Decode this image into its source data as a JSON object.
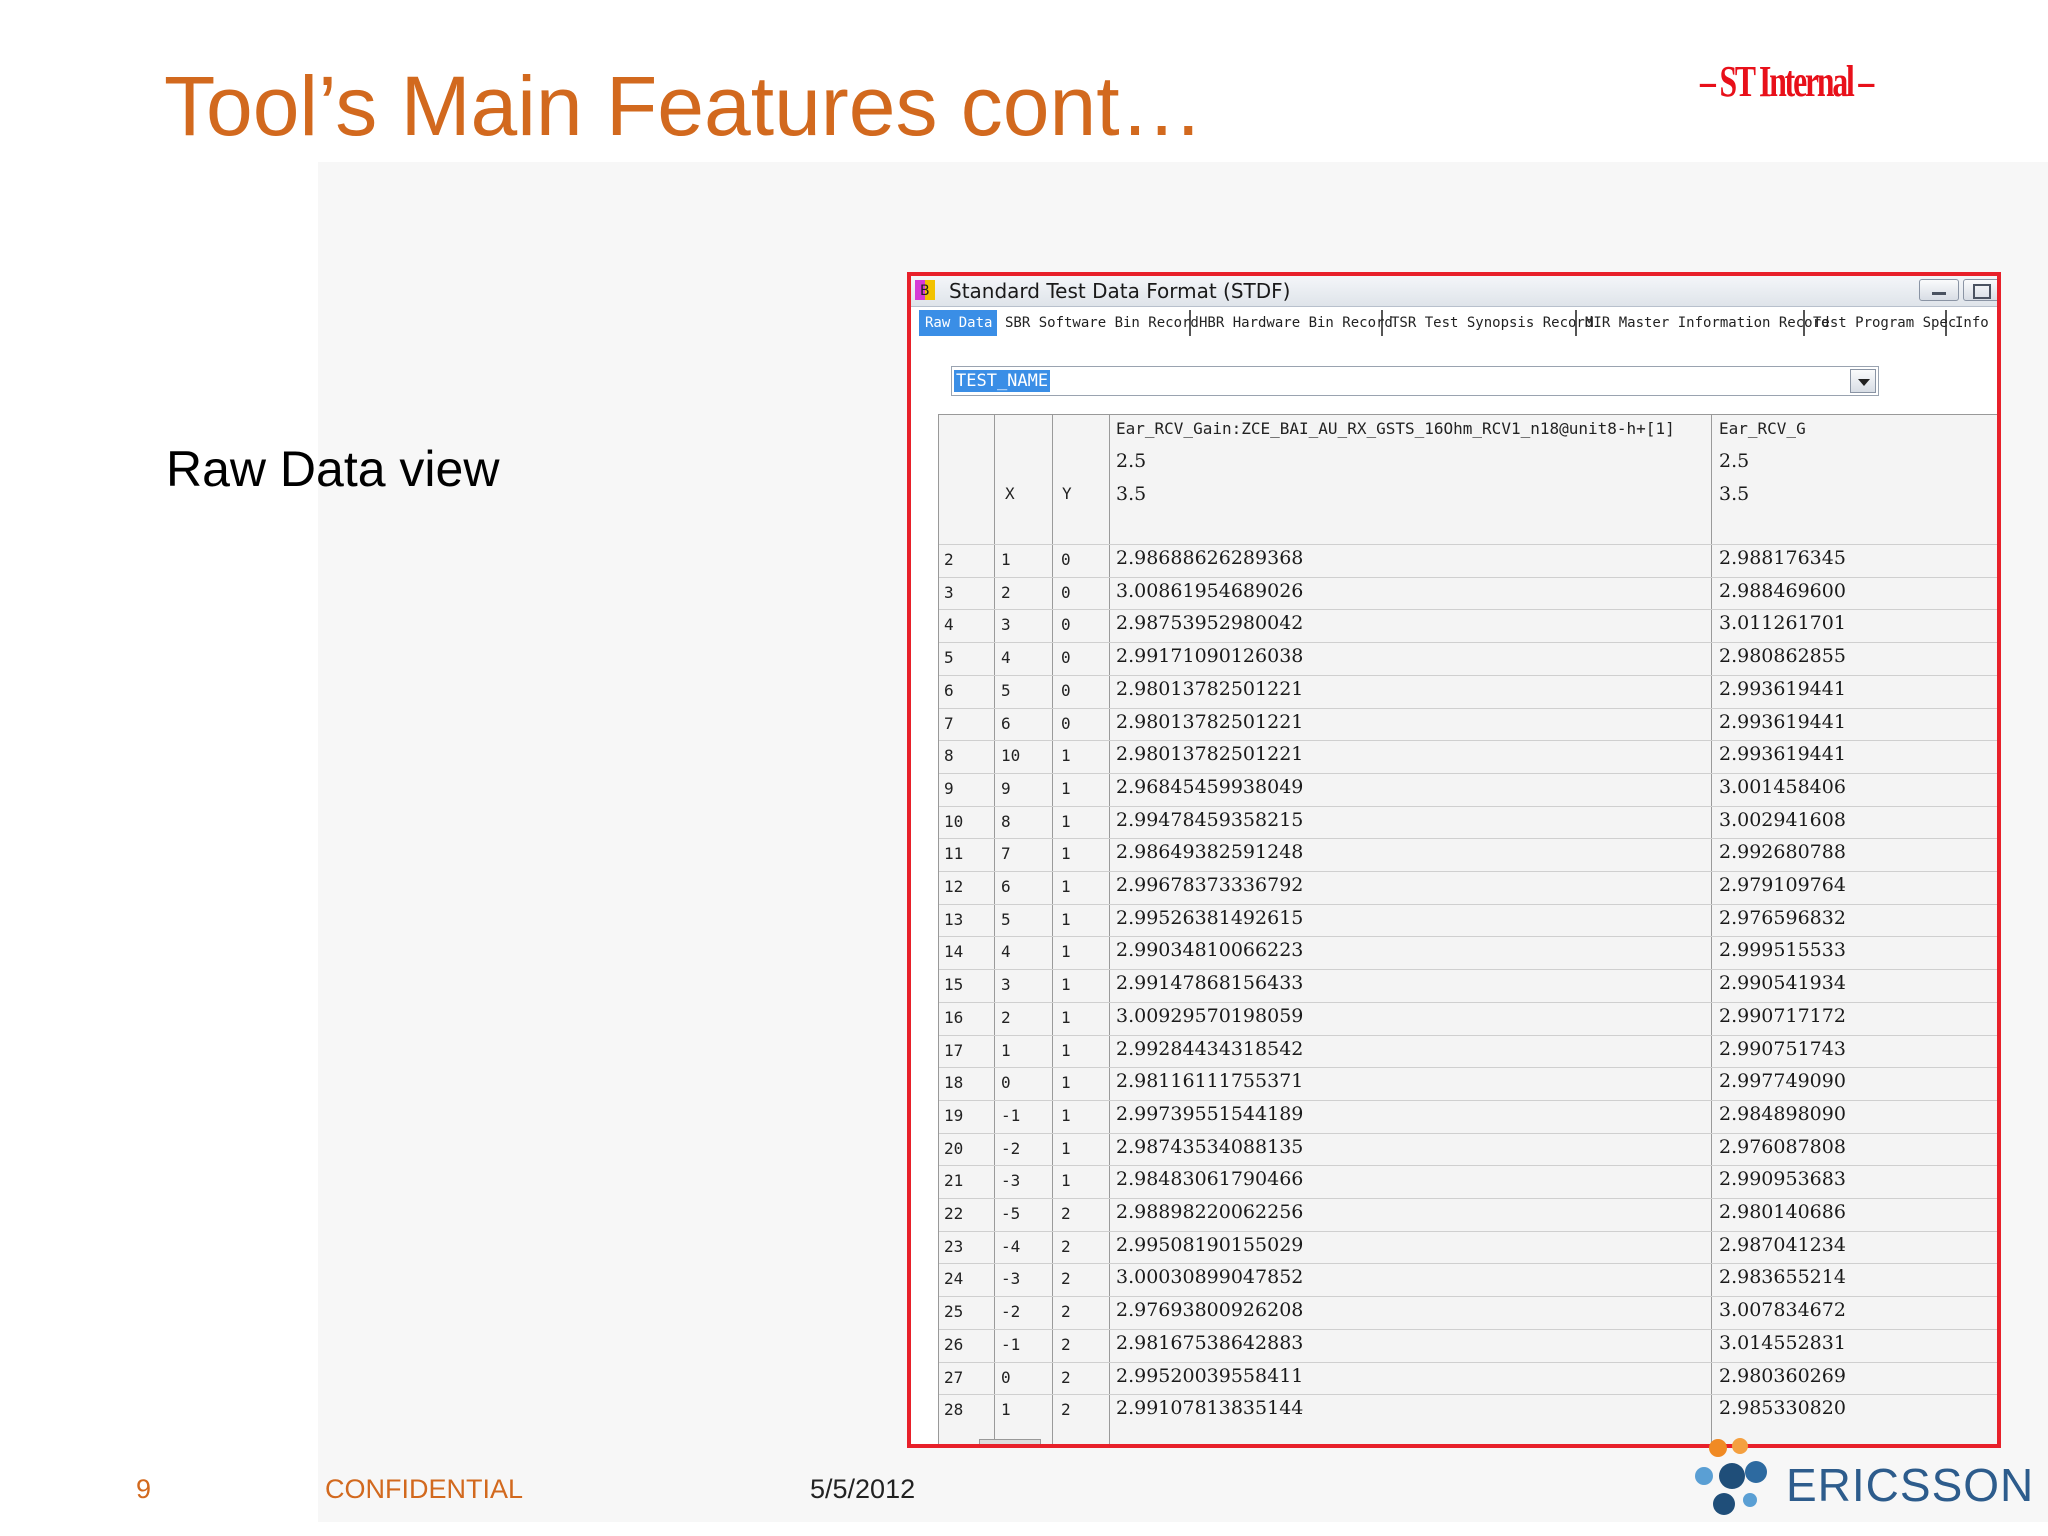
{
  "slide": {
    "title": "Tool’s Main Features cont…",
    "classification_stamp": "– ST Internal –",
    "subheading": "Raw Data view",
    "footer": {
      "page_number": "9",
      "confidential": "CONFIDENTIAL",
      "date": "5/5/2012"
    },
    "logo_text": "ERICSSON"
  },
  "window": {
    "title": "Standard Test Data Format (STDF)",
    "icon": "stdf-app-icon",
    "tabs": [
      {
        "label": "Raw Data",
        "active": true
      },
      {
        "label": "SBR Software Bin Record",
        "active": false
      },
      {
        "label": "HBR Hardware Bin Record",
        "active": false
      },
      {
        "label": "TSR Test Synopsis Record",
        "active": false
      },
      {
        "label": "MIR Master Information Record",
        "active": false
      },
      {
        "label": "Test Program Spec",
        "active": false
      },
      {
        "label": "Info",
        "active": false
      }
    ],
    "test_select": {
      "value": "TEST_NAME"
    },
    "table": {
      "header": {
        "col1_name": "Ear_RCV_Gain:ZCE_BAI_AU_RX_GSTS_16Ohm_RCV1_n18@unit8-h+[1]",
        "col2_name": "Ear_RCV_G",
        "limit_lo_1": "2.5",
        "limit_lo_2": "2.5",
        "limit_hi_1": "3.5",
        "limit_hi_2": "3.5",
        "x_label": "X",
        "y_label": "Y"
      },
      "rows": [
        {
          "idx": "2",
          "x": "1",
          "y": "0",
          "v1": "2.98688626289368",
          "v2": "2.988176345"
        },
        {
          "idx": "3",
          "x": "2",
          "y": "0",
          "v1": "3.00861954689026",
          "v2": "2.988469600"
        },
        {
          "idx": "4",
          "x": "3",
          "y": "0",
          "v1": "2.98753952980042",
          "v2": "3.011261701"
        },
        {
          "idx": "5",
          "x": "4",
          "y": "0",
          "v1": "2.99171090126038",
          "v2": "2.980862855"
        },
        {
          "idx": "6",
          "x": "5",
          "y": "0",
          "v1": "2.98013782501221",
          "v2": "2.993619441"
        },
        {
          "idx": "7",
          "x": "6",
          "y": "0",
          "v1": "2.98013782501221",
          "v2": "2.993619441"
        },
        {
          "idx": "8",
          "x": "10",
          "y": "1",
          "v1": "2.98013782501221",
          "v2": "2.993619441"
        },
        {
          "idx": "9",
          "x": "9",
          "y": "1",
          "v1": "2.96845459938049",
          "v2": "3.001458406"
        },
        {
          "idx": "10",
          "x": "8",
          "y": "1",
          "v1": "2.99478459358215",
          "v2": "3.002941608"
        },
        {
          "idx": "11",
          "x": "7",
          "y": "1",
          "v1": "2.98649382591248",
          "v2": "2.992680788"
        },
        {
          "idx": "12",
          "x": "6",
          "y": "1",
          "v1": "2.99678373336792",
          "v2": "2.979109764"
        },
        {
          "idx": "13",
          "x": "5",
          "y": "1",
          "v1": "2.99526381492615",
          "v2": "2.976596832"
        },
        {
          "idx": "14",
          "x": "4",
          "y": "1",
          "v1": "2.99034810066223",
          "v2": "2.999515533"
        },
        {
          "idx": "15",
          "x": "3",
          "y": "1",
          "v1": "2.99147868156433",
          "v2": "2.990541934"
        },
        {
          "idx": "16",
          "x": "2",
          "y": "1",
          "v1": "3.00929570198059",
          "v2": "2.990717172"
        },
        {
          "idx": "17",
          "x": "1",
          "y": "1",
          "v1": "2.99284434318542",
          "v2": "2.990751743"
        },
        {
          "idx": "18",
          "x": "0",
          "y": "1",
          "v1": "2.98116111755371",
          "v2": "2.997749090"
        },
        {
          "idx": "19",
          "x": "-1",
          "y": "1",
          "v1": "2.99739551544189",
          "v2": "2.984898090"
        },
        {
          "idx": "20",
          "x": "-2",
          "y": "1",
          "v1": "2.98743534088135",
          "v2": "2.976087808"
        },
        {
          "idx": "21",
          "x": "-3",
          "y": "1",
          "v1": "2.98483061790466",
          "v2": "2.990953683"
        },
        {
          "idx": "22",
          "x": "-5",
          "y": "2",
          "v1": "2.98898220062256",
          "v2": "2.980140686"
        },
        {
          "idx": "23",
          "x": "-4",
          "y": "2",
          "v1": "2.99508190155029",
          "v2": "2.987041234"
        },
        {
          "idx": "24",
          "x": "-3",
          "y": "2",
          "v1": "3.00030899047852",
          "v2": "2.983655214"
        },
        {
          "idx": "25",
          "x": "-2",
          "y": "2",
          "v1": "2.97693800926208",
          "v2": "3.007834672"
        },
        {
          "idx": "26",
          "x": "-1",
          "y": "2",
          "v1": "2.98167538642883",
          "v2": "3.014552831"
        },
        {
          "idx": "27",
          "x": "0",
          "y": "2",
          "v1": "2.99520039558411",
          "v2": "2.980360269"
        },
        {
          "idx": "28",
          "x": "1",
          "y": "2",
          "v1": "2.99107813835144",
          "v2": "2.985330820"
        }
      ]
    }
  },
  "colors": {
    "title_orange": "#d2691e",
    "window_border_red": "#e8202a",
    "tab_active_blue": "#3a8ee6",
    "stamp_red": "#e8101a"
  }
}
